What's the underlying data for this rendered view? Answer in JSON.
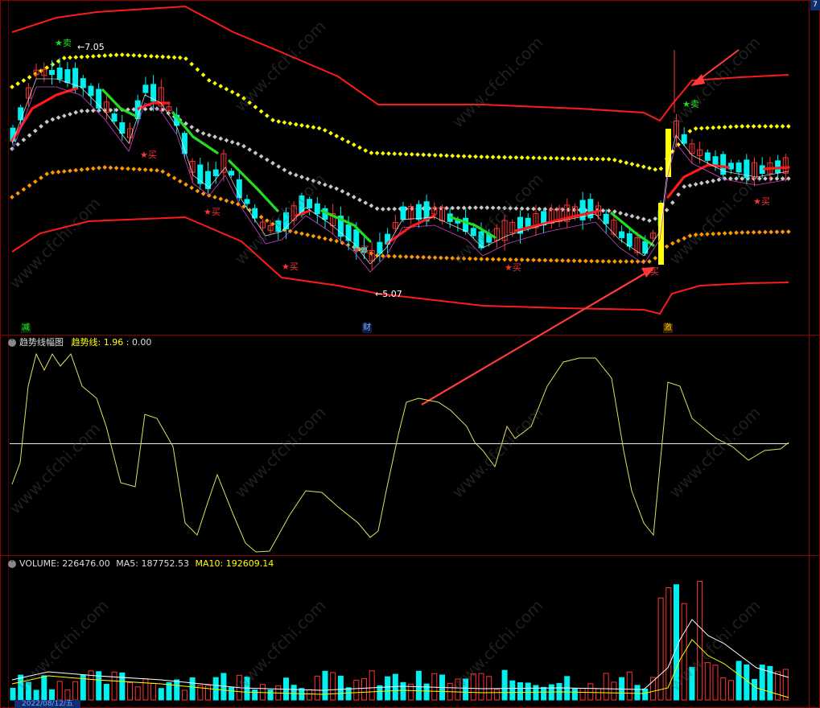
{
  "colors": {
    "background": "#000000",
    "frame": "#8b0000",
    "up_candle": "#ff3333",
    "down_candle": "#00f0f0",
    "band": "#ff1a1a",
    "dots_upper": "#ffff00",
    "dots_mid": "#c8c8c8",
    "dots_lower": "#ff9900",
    "trend_up": "#ff1a1a",
    "trend_down": "#22dd22",
    "osc_line": "#e0e060",
    "annotation_arrow": "#ff3a3a"
  },
  "corner_label": "7",
  "main_panel": {
    "price_high_label": "7.05",
    "price_low_label": "5.07",
    "sell_signals": [
      "★卖",
      "★卖"
    ],
    "buy_signals": [
      "★买",
      "★买",
      "★买",
      "★买",
      "★买",
      "★买",
      "★买"
    ],
    "event_tags": [
      "减",
      "财",
      "激"
    ]
  },
  "indicator_panel": {
    "title": "趋势线幅图",
    "series_label": "趋势线:",
    "value1": "1.96",
    "separator": ":",
    "value2": "0.00"
  },
  "volume_panel": {
    "label": "VOLUME:",
    "volume": "226476.00",
    "ma5_label": "MA5:",
    "ma5": "187752.53",
    "ma10_label": "MA10:",
    "ma10": "192609.14"
  },
  "date_label": "2022/08/12/五",
  "watermark": "www.cfchi.com"
}
